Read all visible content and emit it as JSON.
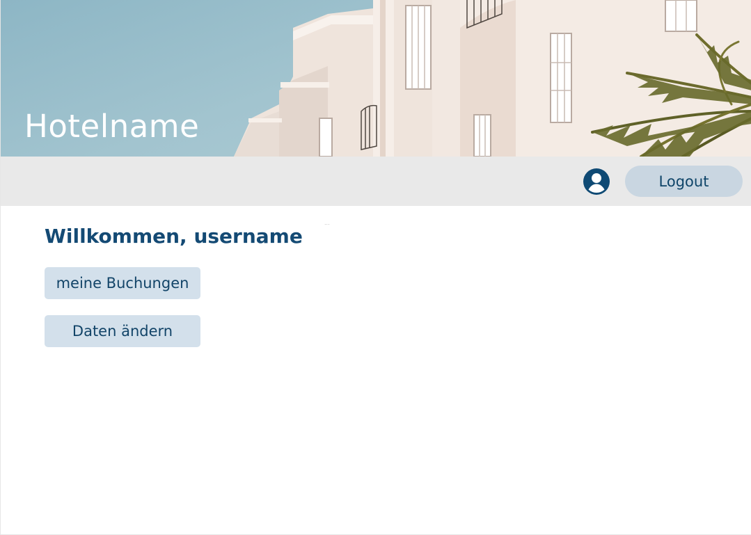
{
  "header": {
    "hotel_name": "Hotelname"
  },
  "toolbar": {
    "user_icon": "user-circle-icon",
    "logout_label": "Logout"
  },
  "main": {
    "welcome_text": "Willkommen, username",
    "faint_marker": "...",
    "buttons": [
      {
        "label": "meine Buchungen"
      },
      {
        "label": "Daten ändern"
      }
    ]
  },
  "colors": {
    "accent": "#144a74",
    "button_bg": "#d3e0eb",
    "logout_bg": "#c9d6e1",
    "toolbar_bg": "#e9e9e9",
    "sky": "#9fc2cd"
  }
}
